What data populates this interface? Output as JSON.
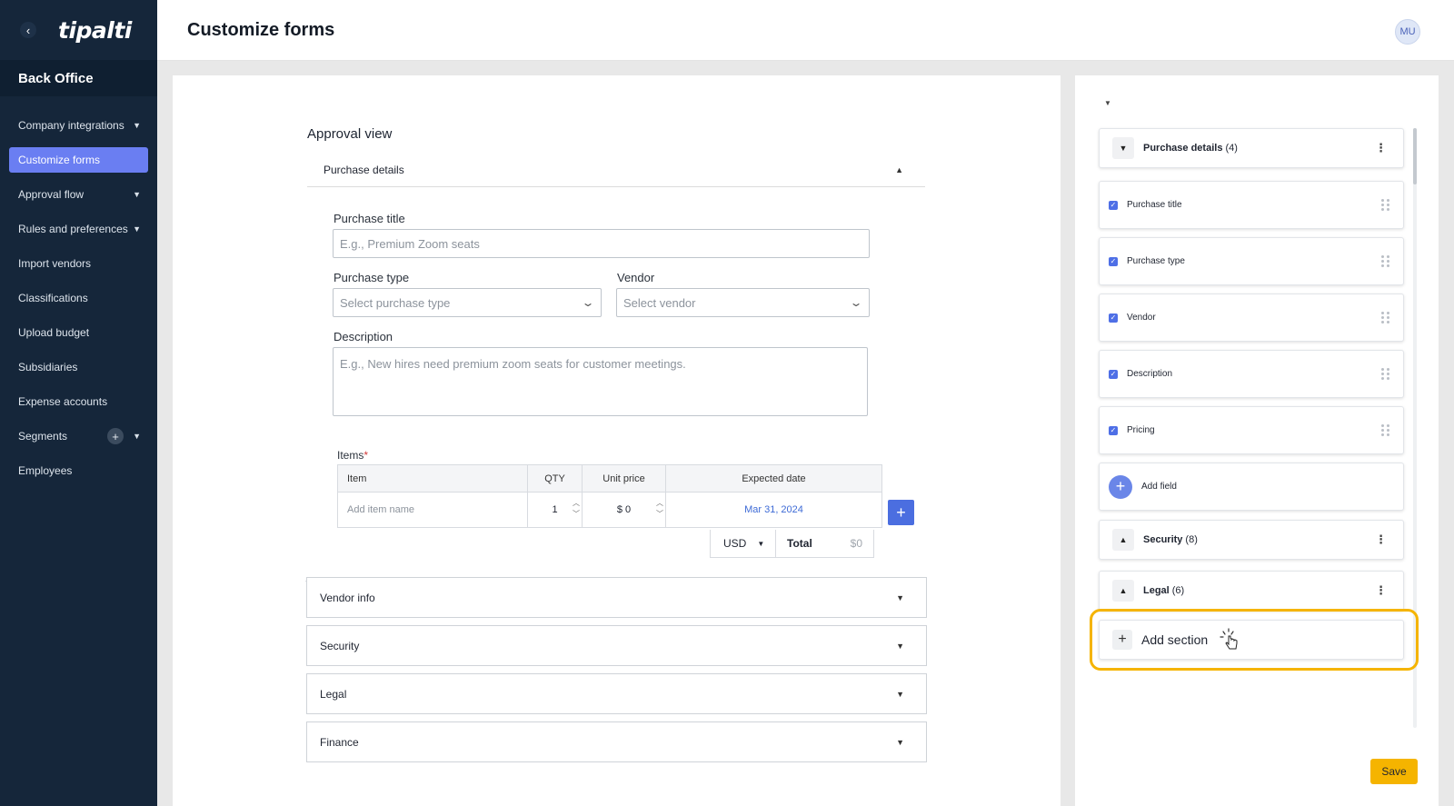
{
  "brand": {
    "logo_text": "tipalti",
    "section_title": "Back Office"
  },
  "sidebar": {
    "items": [
      {
        "label": "Company integrations",
        "has_caret": true
      },
      {
        "label": "Customize forms",
        "active": true
      },
      {
        "label": "Approval flow",
        "has_caret": true
      },
      {
        "label": "Rules and preferences",
        "has_caret": true
      },
      {
        "label": "Import vendors"
      },
      {
        "label": "Classifications"
      },
      {
        "label": "Upload budget"
      },
      {
        "label": "Subsidiaries"
      },
      {
        "label": "Expense accounts"
      },
      {
        "label": "Segments",
        "has_plus": true,
        "has_caret": true
      },
      {
        "label": "Employees"
      }
    ]
  },
  "header": {
    "title": "Customize forms",
    "avatar_initials": "MU"
  },
  "main": {
    "view_title": "Approval view",
    "purchase_details_title": "Purchase details",
    "fields": {
      "purchase_title_label": "Purchase title",
      "purchase_title_placeholder": "E.g., Premium Zoom seats",
      "purchase_type_label": "Purchase type",
      "purchase_type_placeholder": "Select purchase type",
      "vendor_label": "Vendor",
      "vendor_placeholder": "Select vendor",
      "description_label": "Description",
      "description_placeholder": "E.g., New hires need premium zoom seats for customer meetings."
    },
    "items": {
      "label": "Items",
      "required_mark": "*",
      "columns": [
        "Item",
        "QTY",
        "Unit price",
        "Expected date"
      ],
      "row": {
        "item_placeholder": "Add item name",
        "qty": "1",
        "unit_price": "$ 0",
        "expected_date": "Mar 31, 2024"
      },
      "add_button": "+",
      "currency": "USD",
      "total_label": "Total",
      "total_value": "$0"
    },
    "collapsed_sections": [
      "Vendor info",
      "Security",
      "Legal",
      "Finance"
    ]
  },
  "right_panel": {
    "sections": [
      {
        "name": "Purchase details",
        "count": "(4)",
        "expanded": true
      },
      {
        "name": "Security",
        "count": "(8)",
        "expanded": false
      },
      {
        "name": "Legal",
        "count": "(6)",
        "expanded": false
      }
    ],
    "fields": [
      "Purchase title",
      "Purchase type",
      "Vendor",
      "Description",
      "Pricing"
    ],
    "add_field_label": "Add field",
    "add_section_label": "Add section",
    "save_label": "Save",
    "colors": {
      "accent": "#4e6fe6",
      "highlight": "#f5b400",
      "sidebar": "#15263a"
    }
  }
}
